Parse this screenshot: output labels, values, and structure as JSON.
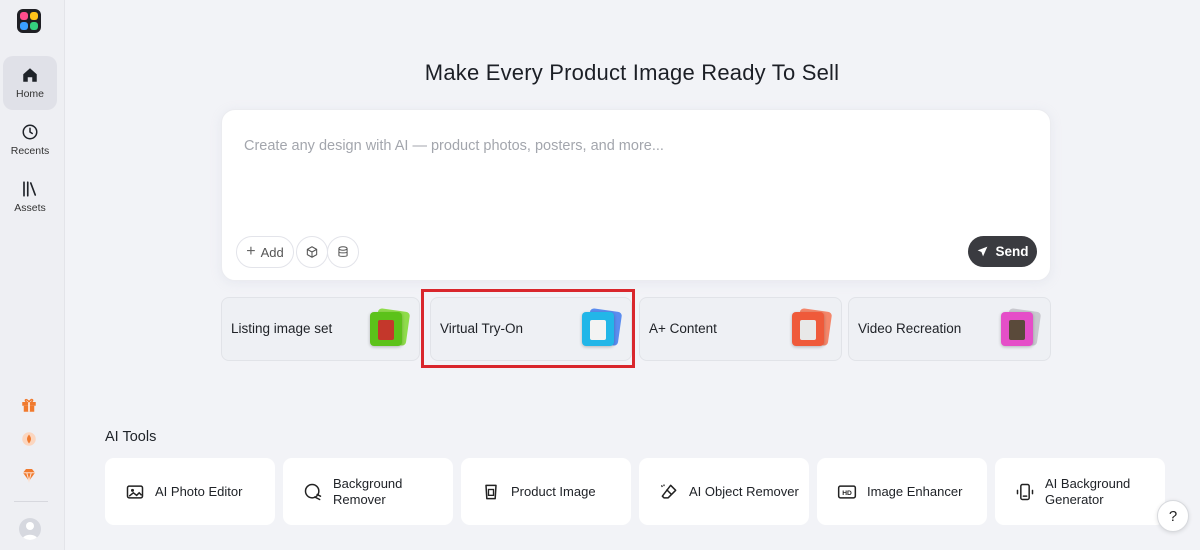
{
  "sidebar": {
    "items": [
      {
        "label": "Home",
        "icon": "home-icon",
        "active": true
      },
      {
        "label": "Recents",
        "icon": "clock-icon",
        "active": false
      },
      {
        "label": "Assets",
        "icon": "library-icon",
        "active": false
      }
    ],
    "bottom_icons": [
      "gift-icon",
      "coin-icon",
      "diamond-icon"
    ]
  },
  "main": {
    "title": "Make Every Product Image Ready To Sell",
    "prompt": {
      "placeholder": "Create any design with AI — product photos, posters, and more...",
      "value": "",
      "add_label": "Add",
      "send_label": "Send"
    },
    "features": [
      {
        "label": "Listing image set",
        "color": "#5cc21a"
      },
      {
        "label": "Virtual Try-On",
        "color": "#22b6e8"
      },
      {
        "label": "A+ Content",
        "color": "#ef5a3a"
      },
      {
        "label": "Video Recreation",
        "color": "#e54ec8"
      }
    ],
    "highlighted_feature": "Virtual Try-On",
    "ai_tools": {
      "title": "AI Tools",
      "items": [
        {
          "line1": "AI Photo Editor",
          "line2": "",
          "icon": "image-edit-icon"
        },
        {
          "line1": "Background",
          "line2": "Remover",
          "icon": "background-remove-icon"
        },
        {
          "line1": "Product Image",
          "line2": "",
          "icon": "product-icon"
        },
        {
          "line1": "AI Object Remover",
          "line2": "",
          "icon": "eraser-icon"
        },
        {
          "line1": "Image Enhancer",
          "line2": "",
          "icon": "hd-icon"
        },
        {
          "line1": "AI Background",
          "line2": "Generator",
          "icon": "background-generate-icon"
        }
      ]
    }
  },
  "help": {
    "label": "?"
  },
  "colors": {
    "highlight": "#d9262c",
    "send_button": "#3a3b40",
    "accent_orange": "#f07a2e"
  }
}
